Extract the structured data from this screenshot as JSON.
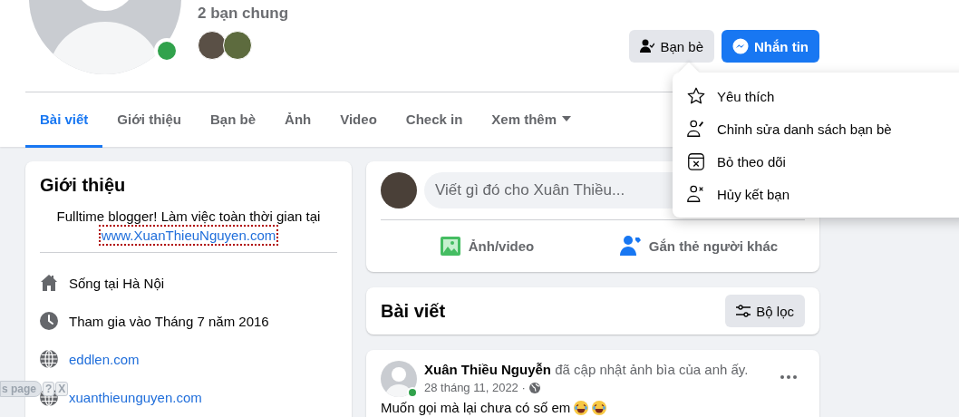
{
  "profile": {
    "mutual_friends": "2 bạn chung",
    "online": true
  },
  "actions": [
    {
      "kind": "friends",
      "label": "Bạn bè"
    },
    {
      "kind": "message",
      "label": "Nhắn tin"
    }
  ],
  "tabs": [
    {
      "label": "Bài viết",
      "selected": true
    },
    {
      "label": "Giới thiệu",
      "selected": false
    },
    {
      "label": "Bạn bè",
      "selected": false
    },
    {
      "label": "Ảnh",
      "selected": false
    },
    {
      "label": "Video",
      "selected": false
    },
    {
      "label": "Check in",
      "selected": false
    },
    {
      "label": "Xem thêm",
      "selected": false,
      "dropdown": true
    }
  ],
  "friend_menu": {
    "items": [
      {
        "label": "Yêu thích"
      },
      {
        "label": "Chỉnh sửa danh sách bạn bè"
      },
      {
        "label": "Bỏ theo dõi"
      },
      {
        "label": "Hủy kết bạn"
      }
    ]
  },
  "intro": {
    "title": "Giới thiệu",
    "bio": "Fulltime blogger! Làm việc toàn thời gian tại",
    "bio_link": "www.XuanThieuNguyen.com",
    "bio_link_focused": true,
    "details": [
      {
        "kind": "text",
        "text": "Sống tại Hà Nội"
      },
      {
        "kind": "text",
        "text": "Tham gia vào Tháng 7 năm 2016"
      },
      {
        "kind": "link",
        "text": "eddlen.com"
      },
      {
        "kind": "link",
        "text": "xuanthieunguyen.com"
      }
    ]
  },
  "composer": {
    "placeholder": "Viết gì đó cho Xuân Thiều...",
    "actions": [
      {
        "label": "Ảnh/video"
      },
      {
        "label": "Gắn thẻ người khác"
      }
    ]
  },
  "posts_header": {
    "title": "Bài viết",
    "filter_button": "Bộ lọc"
  },
  "post": {
    "author": "Xuân Thiều Nguyễn",
    "activity": "đã cập nhật ảnh bìa của anh ấy.",
    "date": "28 tháng 11, 2022 ·",
    "online": true,
    "text": "Muốn gọi mà lại chưa có số em"
  },
  "translate_bar": {
    "label": "s page",
    "buttons": [
      "?",
      "X"
    ]
  }
}
